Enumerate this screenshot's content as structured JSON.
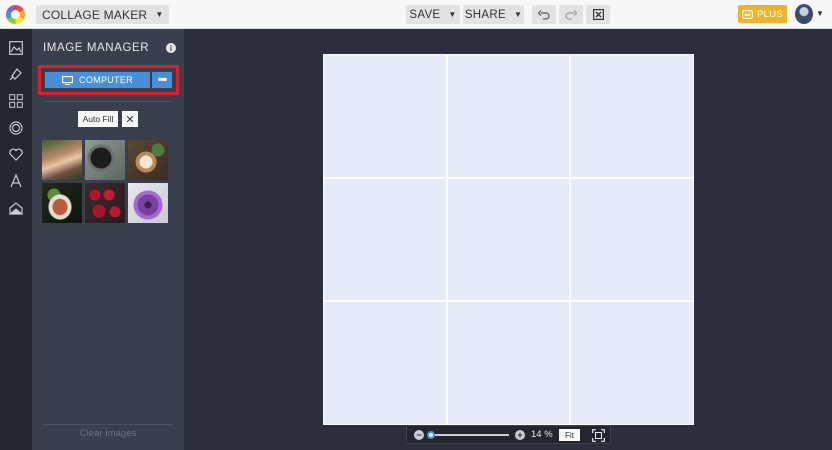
{
  "topbar": {
    "mode_label": "COLLAGE MAKER",
    "save_label": "SAVE",
    "share_label": "SHARE",
    "plus_label": "PLUS",
    "icons": [
      "logo-icon",
      "undo-icon",
      "redo-icon",
      "close-icon",
      "crown-icon",
      "avatar-icon"
    ],
    "accent_color": "#f0b429"
  },
  "iconbar": {
    "items": [
      "image-manager-icon",
      "paint-icon",
      "grid-layout-icon",
      "frame-icon",
      "heart-icon",
      "text-icon",
      "texture-icon"
    ]
  },
  "panel": {
    "title": "IMAGE MANAGER",
    "computer_label": "COMPUTER",
    "more_label": "•••",
    "autofill_label": "Auto Fill",
    "autofill_close": "✕",
    "clear_images_label": "Clear Images",
    "highlight_color": "#e01e2a",
    "button_color": "#4a90d9",
    "thumbnails": [
      "woman-portrait",
      "camera-flatlay",
      "coffee-flatlay",
      "food-plate",
      "raspberries",
      "purple-flower"
    ]
  },
  "canvas": {
    "rows": 3,
    "cols": 3,
    "cell_color": "#e6ebfa"
  },
  "zoom": {
    "level_text": "14 %",
    "level": 14,
    "fit_label": "Fit",
    "minus_label": "−",
    "plus_label": "+"
  }
}
